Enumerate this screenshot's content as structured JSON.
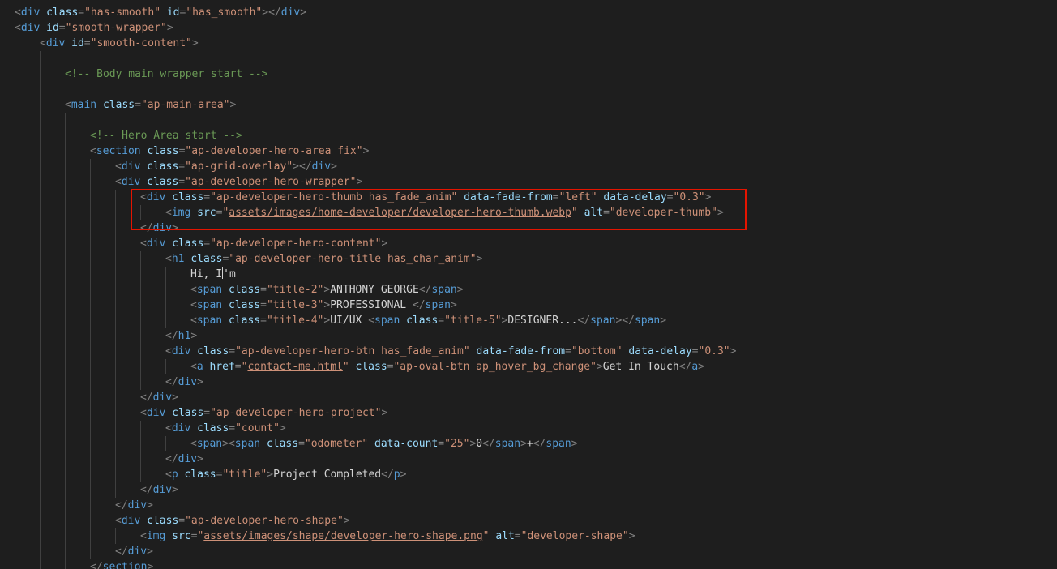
{
  "colors": {
    "background": "#1e1e1e",
    "tag": "#569cd6",
    "punctuation": "#808080",
    "attribute": "#9cdcfe",
    "string": "#ce9178",
    "text": "#d4d4d4",
    "comment": "#6a9955",
    "highlight_border": "#e51400"
  },
  "code_lines": [
    {
      "indent": 0,
      "tokens": [
        [
          "punc",
          "<"
        ],
        [
          "tag",
          "div"
        ],
        [
          "txt",
          " "
        ],
        [
          "attr",
          "class"
        ],
        [
          "punc",
          "="
        ],
        [
          "str",
          "\"has-smooth\""
        ],
        [
          "txt",
          " "
        ],
        [
          "attr",
          "id"
        ],
        [
          "punc",
          "="
        ],
        [
          "str",
          "\"has_smooth\""
        ],
        [
          "punc",
          ">"
        ],
        [
          "punc",
          "</"
        ],
        [
          "tag",
          "div"
        ],
        [
          "punc",
          ">"
        ]
      ]
    },
    {
      "indent": 0,
      "tokens": [
        [
          "punc",
          "<"
        ],
        [
          "tag",
          "div"
        ],
        [
          "txt",
          " "
        ],
        [
          "attr",
          "id"
        ],
        [
          "punc",
          "="
        ],
        [
          "str",
          "\"smooth-wrapper\""
        ],
        [
          "punc",
          ">"
        ]
      ]
    },
    {
      "indent": 1,
      "tokens": [
        [
          "punc",
          "<"
        ],
        [
          "tag",
          "div"
        ],
        [
          "txt",
          " "
        ],
        [
          "attr",
          "id"
        ],
        [
          "punc",
          "="
        ],
        [
          "str",
          "\"smooth-content\""
        ],
        [
          "punc",
          ">"
        ]
      ]
    },
    {
      "indent": 0,
      "tokens": []
    },
    {
      "indent": 2,
      "tokens": [
        [
          "comment",
          "<!-- Body main wrapper start -->"
        ]
      ]
    },
    {
      "indent": 0,
      "tokens": []
    },
    {
      "indent": 2,
      "tokens": [
        [
          "punc",
          "<"
        ],
        [
          "tag",
          "main"
        ],
        [
          "txt",
          " "
        ],
        [
          "attr",
          "class"
        ],
        [
          "punc",
          "="
        ],
        [
          "str",
          "\"ap-main-area\""
        ],
        [
          "punc",
          ">"
        ]
      ]
    },
    {
      "indent": 0,
      "tokens": []
    },
    {
      "indent": 3,
      "tokens": [
        [
          "comment",
          "<!-- Hero Area start -->"
        ]
      ]
    },
    {
      "indent": 3,
      "tokens": [
        [
          "punc",
          "<"
        ],
        [
          "tag",
          "section"
        ],
        [
          "txt",
          " "
        ],
        [
          "attr",
          "class"
        ],
        [
          "punc",
          "="
        ],
        [
          "str",
          "\"ap-developer-hero-area fix\""
        ],
        [
          "punc",
          ">"
        ]
      ]
    },
    {
      "indent": 4,
      "tokens": [
        [
          "punc",
          "<"
        ],
        [
          "tag",
          "div"
        ],
        [
          "txt",
          " "
        ],
        [
          "attr",
          "class"
        ],
        [
          "punc",
          "="
        ],
        [
          "str",
          "\"ap-grid-overlay\""
        ],
        [
          "punc",
          ">"
        ],
        [
          "punc",
          "</"
        ],
        [
          "tag",
          "div"
        ],
        [
          "punc",
          ">"
        ]
      ]
    },
    {
      "indent": 4,
      "tokens": [
        [
          "punc",
          "<"
        ],
        [
          "tag",
          "div"
        ],
        [
          "txt",
          " "
        ],
        [
          "attr",
          "class"
        ],
        [
          "punc",
          "="
        ],
        [
          "str",
          "\"ap-developer-hero-wrapper\""
        ],
        [
          "punc",
          ">"
        ]
      ]
    },
    {
      "indent": 5,
      "tokens": [
        [
          "punc",
          "<"
        ],
        [
          "tag",
          "div"
        ],
        [
          "txt",
          " "
        ],
        [
          "attr",
          "class"
        ],
        [
          "punc",
          "="
        ],
        [
          "str",
          "\"ap-developer-hero-thumb has_fade_anim\""
        ],
        [
          "txt",
          " "
        ],
        [
          "attr",
          "data-fade-from"
        ],
        [
          "punc",
          "="
        ],
        [
          "str",
          "\"left\""
        ],
        [
          "txt",
          " "
        ],
        [
          "attr",
          "data-delay"
        ],
        [
          "punc",
          "="
        ],
        [
          "str",
          "\"0.3\""
        ],
        [
          "punc",
          ">"
        ]
      ]
    },
    {
      "indent": 6,
      "tokens": [
        [
          "punc",
          "<"
        ],
        [
          "tag",
          "img"
        ],
        [
          "txt",
          " "
        ],
        [
          "attr",
          "src"
        ],
        [
          "punc",
          "="
        ],
        [
          "str",
          "\""
        ],
        [
          "str link",
          "assets/images/home-developer/developer-hero-thumb.webp"
        ],
        [
          "str",
          "\""
        ],
        [
          "txt",
          " "
        ],
        [
          "attr",
          "alt"
        ],
        [
          "punc",
          "="
        ],
        [
          "str",
          "\"developer-thumb\""
        ],
        [
          "punc",
          ">"
        ]
      ]
    },
    {
      "indent": 5,
      "tokens": [
        [
          "punc",
          "</"
        ],
        [
          "tag",
          "div"
        ],
        [
          "punc",
          ">"
        ]
      ]
    },
    {
      "indent": 5,
      "tokens": [
        [
          "punc",
          "<"
        ],
        [
          "tag",
          "div"
        ],
        [
          "txt",
          " "
        ],
        [
          "attr",
          "class"
        ],
        [
          "punc",
          "="
        ],
        [
          "str",
          "\"ap-developer-hero-content\""
        ],
        [
          "punc",
          ">"
        ]
      ]
    },
    {
      "indent": 6,
      "tokens": [
        [
          "punc",
          "<"
        ],
        [
          "tag",
          "h1"
        ],
        [
          "txt",
          " "
        ],
        [
          "attr",
          "class"
        ],
        [
          "punc",
          "="
        ],
        [
          "str",
          "\"ap-developer-hero-title has_char_anim\""
        ],
        [
          "punc",
          ">"
        ]
      ]
    },
    {
      "indent": 7,
      "tokens": [
        [
          "txt",
          "Hi, I"
        ],
        [
          "cursor",
          ""
        ],
        [
          "txt",
          "'m"
        ]
      ]
    },
    {
      "indent": 7,
      "tokens": [
        [
          "punc",
          "<"
        ],
        [
          "tag",
          "span"
        ],
        [
          "txt",
          " "
        ],
        [
          "attr",
          "class"
        ],
        [
          "punc",
          "="
        ],
        [
          "str",
          "\"title-2\""
        ],
        [
          "punc",
          ">"
        ],
        [
          "txt",
          "ANTHONY GEORGE"
        ],
        [
          "punc",
          "</"
        ],
        [
          "tag",
          "span"
        ],
        [
          "punc",
          ">"
        ]
      ]
    },
    {
      "indent": 7,
      "tokens": [
        [
          "punc",
          "<"
        ],
        [
          "tag",
          "span"
        ],
        [
          "txt",
          " "
        ],
        [
          "attr",
          "class"
        ],
        [
          "punc",
          "="
        ],
        [
          "str",
          "\"title-3\""
        ],
        [
          "punc",
          ">"
        ],
        [
          "txt",
          "PROFESSIONAL "
        ],
        [
          "punc",
          "</"
        ],
        [
          "tag",
          "span"
        ],
        [
          "punc",
          ">"
        ]
      ]
    },
    {
      "indent": 7,
      "tokens": [
        [
          "punc",
          "<"
        ],
        [
          "tag",
          "span"
        ],
        [
          "txt",
          " "
        ],
        [
          "attr",
          "class"
        ],
        [
          "punc",
          "="
        ],
        [
          "str",
          "\"title-4\""
        ],
        [
          "punc",
          ">"
        ],
        [
          "txt",
          "UI/UX "
        ],
        [
          "punc",
          "<"
        ],
        [
          "tag",
          "span"
        ],
        [
          "txt",
          " "
        ],
        [
          "attr",
          "class"
        ],
        [
          "punc",
          "="
        ],
        [
          "str",
          "\"title-5\""
        ],
        [
          "punc",
          ">"
        ],
        [
          "txt",
          "DESIGNER..."
        ],
        [
          "punc",
          "</"
        ],
        [
          "tag",
          "span"
        ],
        [
          "punc",
          ">"
        ],
        [
          "punc",
          "</"
        ],
        [
          "tag",
          "span"
        ],
        [
          "punc",
          ">"
        ]
      ]
    },
    {
      "indent": 6,
      "tokens": [
        [
          "punc",
          "</"
        ],
        [
          "tag",
          "h1"
        ],
        [
          "punc",
          ">"
        ]
      ]
    },
    {
      "indent": 6,
      "tokens": [
        [
          "punc",
          "<"
        ],
        [
          "tag",
          "div"
        ],
        [
          "txt",
          " "
        ],
        [
          "attr",
          "class"
        ],
        [
          "punc",
          "="
        ],
        [
          "str",
          "\"ap-developer-hero-btn has_fade_anim\""
        ],
        [
          "txt",
          " "
        ],
        [
          "attr",
          "data-fade-from"
        ],
        [
          "punc",
          "="
        ],
        [
          "str",
          "\"bottom\""
        ],
        [
          "txt",
          " "
        ],
        [
          "attr",
          "data-delay"
        ],
        [
          "punc",
          "="
        ],
        [
          "str",
          "\"0.3\""
        ],
        [
          "punc",
          ">"
        ]
      ]
    },
    {
      "indent": 7,
      "tokens": [
        [
          "punc",
          "<"
        ],
        [
          "tag",
          "a"
        ],
        [
          "txt",
          " "
        ],
        [
          "attr",
          "href"
        ],
        [
          "punc",
          "="
        ],
        [
          "str",
          "\""
        ],
        [
          "str link",
          "contact-me.html"
        ],
        [
          "str",
          "\""
        ],
        [
          "txt",
          " "
        ],
        [
          "attr",
          "class"
        ],
        [
          "punc",
          "="
        ],
        [
          "str",
          "\"ap-oval-btn ap_hover_bg_change\""
        ],
        [
          "punc",
          ">"
        ],
        [
          "txt",
          "Get In Touch"
        ],
        [
          "punc",
          "</"
        ],
        [
          "tag",
          "a"
        ],
        [
          "punc",
          ">"
        ]
      ]
    },
    {
      "indent": 6,
      "tokens": [
        [
          "punc",
          "</"
        ],
        [
          "tag",
          "div"
        ],
        [
          "punc",
          ">"
        ]
      ]
    },
    {
      "indent": 5,
      "tokens": [
        [
          "punc",
          "</"
        ],
        [
          "tag",
          "div"
        ],
        [
          "punc",
          ">"
        ]
      ]
    },
    {
      "indent": 5,
      "tokens": [
        [
          "punc",
          "<"
        ],
        [
          "tag",
          "div"
        ],
        [
          "txt",
          " "
        ],
        [
          "attr",
          "class"
        ],
        [
          "punc",
          "="
        ],
        [
          "str",
          "\"ap-developer-hero-project\""
        ],
        [
          "punc",
          ">"
        ]
      ]
    },
    {
      "indent": 6,
      "tokens": [
        [
          "punc",
          "<"
        ],
        [
          "tag",
          "div"
        ],
        [
          "txt",
          " "
        ],
        [
          "attr",
          "class"
        ],
        [
          "punc",
          "="
        ],
        [
          "str",
          "\"count\""
        ],
        [
          "punc",
          ">"
        ]
      ]
    },
    {
      "indent": 7,
      "tokens": [
        [
          "punc",
          "<"
        ],
        [
          "tag",
          "span"
        ],
        [
          "punc",
          ">"
        ],
        [
          "punc",
          "<"
        ],
        [
          "tag",
          "span"
        ],
        [
          "txt",
          " "
        ],
        [
          "attr",
          "class"
        ],
        [
          "punc",
          "="
        ],
        [
          "str",
          "\"odometer\""
        ],
        [
          "txt",
          " "
        ],
        [
          "attr",
          "data-count"
        ],
        [
          "punc",
          "="
        ],
        [
          "str",
          "\"25\""
        ],
        [
          "punc",
          ">"
        ],
        [
          "txt",
          "0"
        ],
        [
          "punc",
          "</"
        ],
        [
          "tag",
          "span"
        ],
        [
          "punc",
          ">"
        ],
        [
          "txt",
          "+"
        ],
        [
          "punc",
          "</"
        ],
        [
          "tag",
          "span"
        ],
        [
          "punc",
          ">"
        ]
      ]
    },
    {
      "indent": 6,
      "tokens": [
        [
          "punc",
          "</"
        ],
        [
          "tag",
          "div"
        ],
        [
          "punc",
          ">"
        ]
      ]
    },
    {
      "indent": 6,
      "tokens": [
        [
          "punc",
          "<"
        ],
        [
          "tag",
          "p"
        ],
        [
          "txt",
          " "
        ],
        [
          "attr",
          "class"
        ],
        [
          "punc",
          "="
        ],
        [
          "str",
          "\"title\""
        ],
        [
          "punc",
          ">"
        ],
        [
          "txt",
          "Project Completed"
        ],
        [
          "punc",
          "</"
        ],
        [
          "tag",
          "p"
        ],
        [
          "punc",
          ">"
        ]
      ]
    },
    {
      "indent": 5,
      "tokens": [
        [
          "punc",
          "</"
        ],
        [
          "tag",
          "div"
        ],
        [
          "punc",
          ">"
        ]
      ]
    },
    {
      "indent": 4,
      "tokens": [
        [
          "punc",
          "</"
        ],
        [
          "tag",
          "div"
        ],
        [
          "punc",
          ">"
        ]
      ]
    },
    {
      "indent": 4,
      "tokens": [
        [
          "punc",
          "<"
        ],
        [
          "tag",
          "div"
        ],
        [
          "txt",
          " "
        ],
        [
          "attr",
          "class"
        ],
        [
          "punc",
          "="
        ],
        [
          "str",
          "\"ap-developer-hero-shape\""
        ],
        [
          "punc",
          ">"
        ]
      ]
    },
    {
      "indent": 5,
      "tokens": [
        [
          "punc",
          "<"
        ],
        [
          "tag",
          "img"
        ],
        [
          "txt",
          " "
        ],
        [
          "attr",
          "src"
        ],
        [
          "punc",
          "="
        ],
        [
          "str",
          "\""
        ],
        [
          "str link",
          "assets/images/shape/developer-hero-shape.png"
        ],
        [
          "str",
          "\""
        ],
        [
          "txt",
          " "
        ],
        [
          "attr",
          "alt"
        ],
        [
          "punc",
          "="
        ],
        [
          "str",
          "\"developer-shape\""
        ],
        [
          "punc",
          ">"
        ]
      ]
    },
    {
      "indent": 4,
      "tokens": [
        [
          "punc",
          "</"
        ],
        [
          "tag",
          "div"
        ],
        [
          "punc",
          ">"
        ]
      ]
    },
    {
      "indent": 3,
      "tokens": [
        [
          "punc",
          "</"
        ],
        [
          "tag",
          "section"
        ],
        [
          "punc",
          ">"
        ]
      ]
    }
  ]
}
